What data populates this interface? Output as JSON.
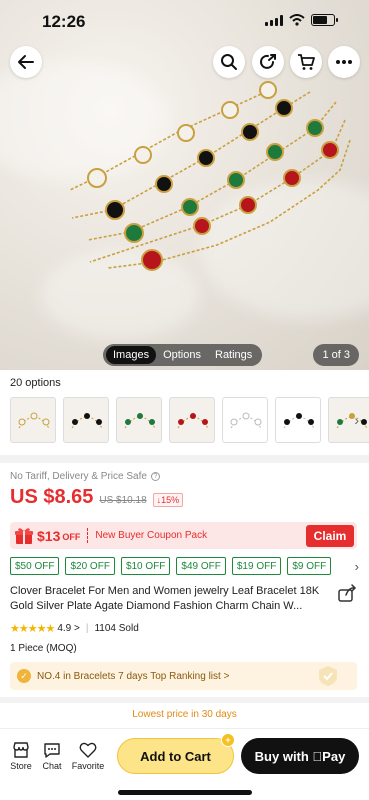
{
  "status_bar": {
    "time": "12:26"
  },
  "gallery": {
    "tabs": [
      {
        "label": "Images",
        "active": true
      },
      {
        "label": "Options",
        "active": false
      },
      {
        "label": "Ratings",
        "active": false
      }
    ],
    "counter": "1 of 3"
  },
  "header_icons": [
    "back-arrow-icon",
    "search-icon",
    "share-icon",
    "cart-icon",
    "more-icon"
  ],
  "options": {
    "label": "20 options",
    "thumbnails": [
      {
        "name": "white-clover",
        "color": "#f6f3ec"
      },
      {
        "name": "black-clover",
        "color": "#111111"
      },
      {
        "name": "green-clover",
        "color": "#1e7a3c"
      },
      {
        "name": "red-clover",
        "color": "#b5151b"
      },
      {
        "name": "white-clover-silver",
        "color": "#ffffff"
      },
      {
        "name": "black-clover-silver",
        "color": "#111111"
      },
      {
        "name": "mixed-clover",
        "color": "#1e7a3c"
      }
    ]
  },
  "product": {
    "safe_text": "No Tariff, Delivery & Price Safe",
    "price": "US $8.65",
    "old_price": "US $10.18",
    "discount": "↓15%",
    "title": "Clover Bracelet For Men and Women jewelry Leaf Bracelet 18K Gold Silver Plate Agate Diamond Fashion Charm Chain W...",
    "rating_value": "4.9 >",
    "sold": "1104 Sold",
    "moq": "1 Piece (MOQ)"
  },
  "coupon": {
    "amount": "$13",
    "off": "OFF",
    "text": "New Buyer Coupon Pack",
    "claim": "Claim"
  },
  "chips": [
    "$50 OFF",
    "$20 OFF",
    "$10 OFF",
    "$49 OFF",
    "$19 OFF",
    "$9 OFF"
  ],
  "ranking": {
    "text": "NO.4 in Bracelets 7 days Top Ranking list >"
  },
  "lowest_price": "Lowest price in 30 days",
  "bottom_bar": {
    "store": "Store",
    "chat": "Chat",
    "favorite": "Favorite",
    "add_to_cart": "Add to Cart",
    "cart_badge": "+",
    "buy": "Buy with Pay"
  },
  "colors": {
    "accent_red": "#e62e2e",
    "chip_green": "#1d8a3b",
    "cart_yellow": "#fde488",
    "buy_black": "#111111"
  }
}
